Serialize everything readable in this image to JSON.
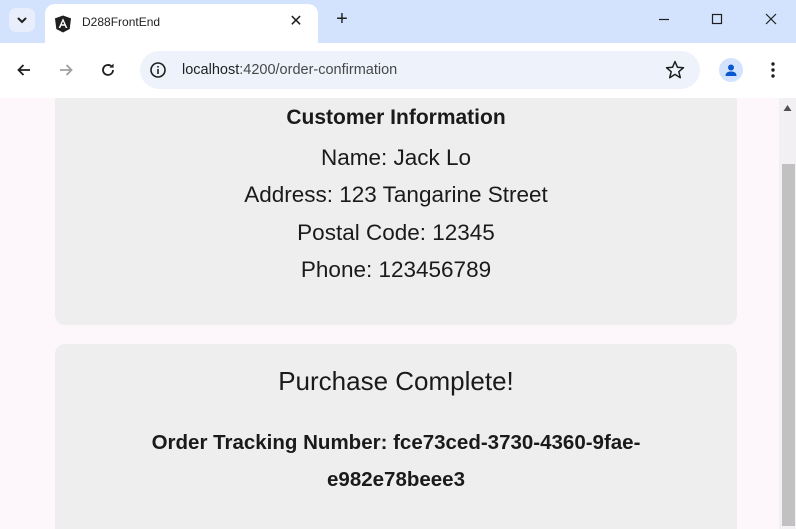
{
  "tab": {
    "title": "D288FrontEnd"
  },
  "window_controls": {
    "minimize": "minimize-icon",
    "maximize": "maximize-icon",
    "close": "close-icon"
  },
  "address_bar": {
    "host": "localhost",
    "port": ":4200",
    "path": "/order-confirmation"
  },
  "customer_card": {
    "heading": "Customer Information",
    "lines": [
      "Name: Jack Lo",
      "Address: 123 Tangarine Street",
      "Postal Code: 12345",
      "Phone: 123456789"
    ]
  },
  "purchase_card": {
    "heading": "Purchase Complete!",
    "tracking_line1": "Order Tracking Number: fce73ced-3730-4360-9fae-",
    "tracking_line2": "e982e78beee3"
  },
  "colors": {
    "tabstrip": "#d3e3fd",
    "card_background": "#eeeeee",
    "page_background": "#fdf7fc",
    "profile_accent": "#0b57d0"
  }
}
